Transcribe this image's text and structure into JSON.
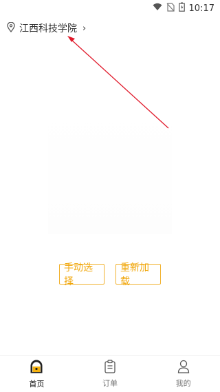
{
  "status": {
    "time": "10:17"
  },
  "location": {
    "name": "江西科技学院",
    "chevron": "›"
  },
  "buttons": {
    "manual_select": "手动选择",
    "reload": "重新加载"
  },
  "tabs": [
    {
      "label": "首页",
      "icon": "home-icon",
      "active": true
    },
    {
      "label": "订单",
      "icon": "order-icon",
      "active": false
    },
    {
      "label": "我的",
      "icon": "user-icon",
      "active": false
    }
  ],
  "colors": {
    "accent": "#f1a70c",
    "annotation_arrow": "#e0192a"
  }
}
